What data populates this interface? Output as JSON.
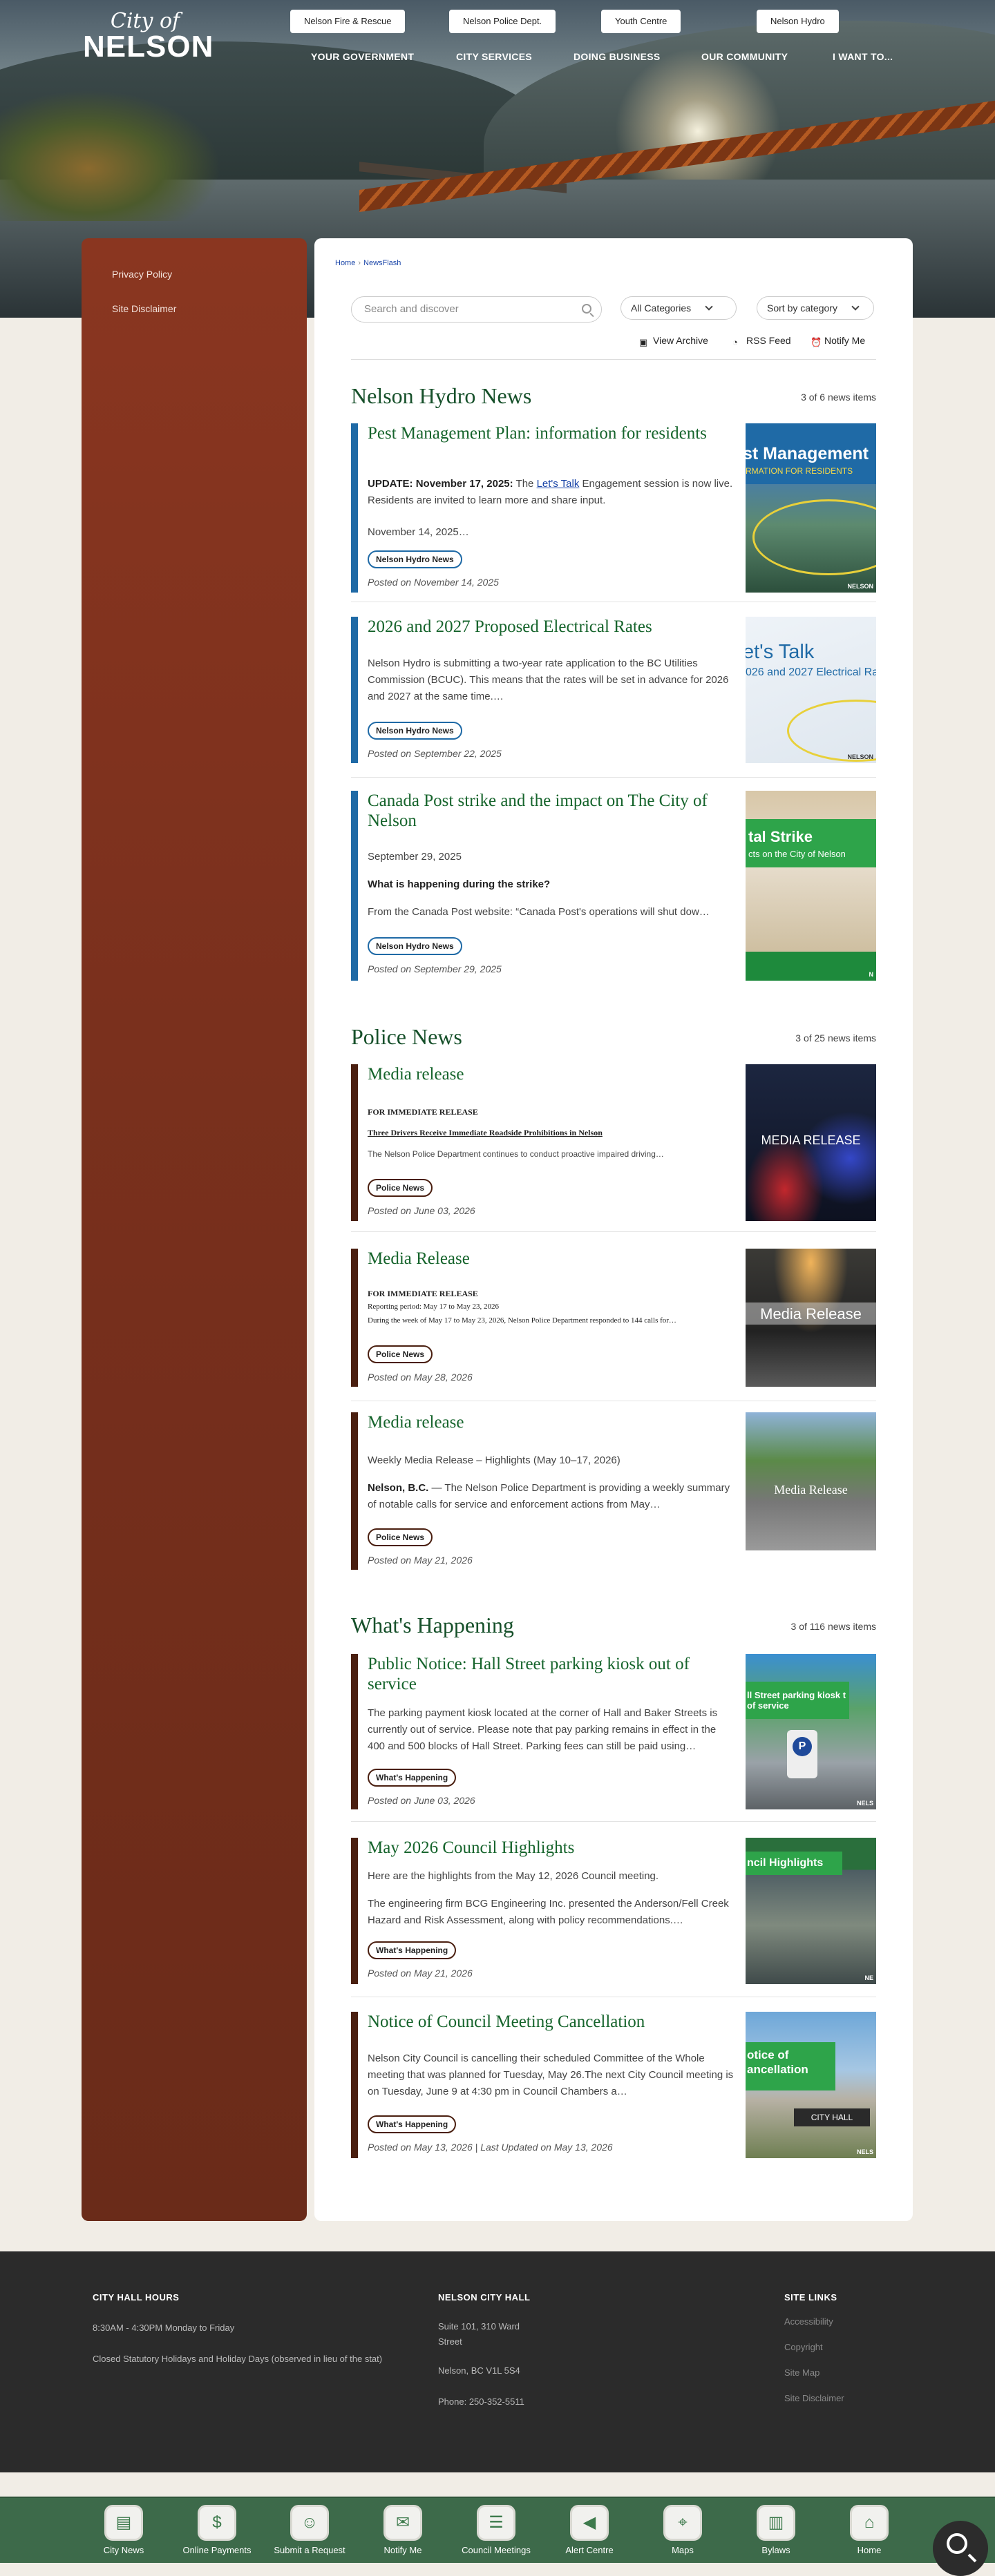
{
  "logo": {
    "city": "City of",
    "name": "NELSON"
  },
  "quick_links": [
    "Nelson Fire & Rescue",
    "Nelson Police Dept.",
    "Youth Centre",
    "Nelson Hydro"
  ],
  "nav": [
    "YOUR GOVERNMENT",
    "CITY SERVICES",
    "DOING BUSINESS",
    "OUR COMMUNITY",
    "I WANT TO..."
  ],
  "sidebar": {
    "links": [
      "Privacy Policy",
      "Site Disclaimer"
    ]
  },
  "breadcrumb": {
    "home": "Home",
    "sep": "›",
    "current": "NewsFlash"
  },
  "search": {
    "placeholder": "Search and discover"
  },
  "filters": {
    "category": "All Categories",
    "sort": "Sort by category"
  },
  "tools": {
    "archive": "View Archive",
    "rss": "RSS Feed",
    "notify": "Notify Me"
  },
  "colors": {
    "hydro": "#1f6aa6",
    "police": "#4a1f10",
    "happening": "#4a1f10",
    "title_green": "#16642c"
  },
  "sections": [
    {
      "title": "Nelson Hydro News",
      "count": "3 of 6 news items",
      "items": [
        {
          "title": "Pest Management Plan: information for residents",
          "update_label": "UPDATE: November 17, 2025:",
          "update_pre": " The ",
          "update_link": "Let's Talk",
          "update_post": " Engagement session is now live. Residents are invited to learn more and share input.",
          "date_line": "November 14, 2025…",
          "tag": "Nelson Hydro News",
          "posted": "Posted on November 14, 2025",
          "thumb": {
            "line1": "st Management",
            "line2": "RMATION FOR RESIDENTS",
            "corner": "NELSON"
          }
        },
        {
          "title": "2026 and 2027 Proposed Electrical Rates",
          "body": "Nelson Hydro is submitting a two-year rate application to the BC Utilities Commission (BCUC). This means that the rates will be set in advance for 2026 and 2027 at the same time.…",
          "tag": "Nelson Hydro News",
          "posted": "Posted on September 22, 2025",
          "thumb": {
            "line1": "et's Talk",
            "line2": "026 and 2027 Electrical Ra",
            "corner": "NELSON"
          }
        },
        {
          "title": "Canada Post strike and the impact on The City of Nelson",
          "date_line": "September 29, 2025",
          "question": "What is happening during the strike?",
          "body": "From the Canada Post website: “Canada Post's operations will shut dow…",
          "tag": "Nelson Hydro News",
          "posted": "Posted on September 29, 2025",
          "thumb": {
            "line1": "tal Strike",
            "line2": "cts on the City of Nelson",
            "corner": "N"
          }
        }
      ]
    },
    {
      "title": "Police News",
      "count": "3 of 25 news items",
      "items": [
        {
          "title": "Media release",
          "heading": "FOR IMMEDIATE RELEASE",
          "sub": "Three Drivers Receive Immediate Roadside Prohibitions in Nelson",
          "body": "The Nelson Police Department continues to conduct proactive impaired driving…",
          "tag": "Police News",
          "posted": "Posted on June 03, 2026",
          "thumb": {
            "line1": "MEDIA RELEASE"
          }
        },
        {
          "title": "Media Release",
          "heading": "FOR IMMEDIATE RELEASE",
          "sub": "Reporting period: May 17 to May 23, 2026",
          "body": "During the week of May 17 to May 23, 2026, Nelson Police Department responded to 144 calls for…",
          "tag": "Police News",
          "posted": "Posted on May 28, 2026",
          "thumb": {
            "line1": "Media Release"
          }
        },
        {
          "title": "Media release",
          "heading": "Weekly Media Release – Highlights (May 10–17, 2026)",
          "lead": "Nelson, B.C.",
          "body": " — The Nelson Police Department is providing a weekly summary of notable calls for service and enforcement actions from May…",
          "tag": "Police News",
          "posted": "Posted on May 21, 2026",
          "thumb": {
            "line1": "Media Release"
          }
        }
      ]
    },
    {
      "title": "What's Happening",
      "count": "3 of 116 news items",
      "items": [
        {
          "title": "Public Notice: Hall Street parking kiosk out of service",
          "body": "The parking payment kiosk located at the corner of Hall and Baker Streets is currently out of service. Please note that pay parking remains in effect in the 400 and 500 blocks of Hall Street. Parking fees can still be paid using…",
          "tag": "What's Happening",
          "posted": "Posted on June 03, 2026",
          "thumb": {
            "line1": "ll Street parking kiosk t of service",
            "corner": "NELS"
          }
        },
        {
          "title": "May 2026 Council Highlights",
          "line1": "Here are the highlights from the May 12, 2026 Council meeting.",
          "body": "The engineering firm BCG Engineering Inc. presented the Anderson/Fell Creek Hazard and Risk Assessment, along with policy recommendations.…",
          "tag": "What's Happening",
          "posted": "Posted on May 21, 2026",
          "thumb": {
            "line1": "ncil Highlights",
            "corner": "NE"
          }
        },
        {
          "title": "Notice of Council Meeting Cancellation",
          "body": "Nelson City Council is cancelling their scheduled Committee of the Whole meeting that was planned for Tuesday, May 26.The next City Council meeting is on Tuesday, June 9 at 4:30 pm in Council Chambers a…",
          "tag": "What's Happening",
          "posted": "Posted on May 13, 2026 | Last Updated on May 13, 2026",
          "thumb": {
            "line1": "otice of ancellation",
            "sign": "CITY HALL",
            "corner": "NELS"
          }
        }
      ]
    }
  ],
  "footer": {
    "hours_title": "CITY HALL HOURS",
    "hours": "8:30AM - 4:30PM Monday to Friday",
    "closed": "Closed Statutory Holidays and Holiday Days (observed in lieu of the stat)",
    "hall_title": "NELSON CITY HALL",
    "address1": "Suite 101, 310 Ward Street",
    "address2": "Nelson, BC V1L 5S4",
    "phone": "Phone: 250-352-5511",
    "links_title": "SITE LINKS",
    "links": [
      "Accessibility",
      "Copyright",
      "Site Map",
      "Site Disclaimer"
    ]
  },
  "bottom_bar": [
    {
      "label": "City News",
      "icon": "newspaper-icon"
    },
    {
      "label": "Online Payments",
      "icon": "dollar-icon"
    },
    {
      "label": "Submit a Request",
      "icon": "person-icon"
    },
    {
      "label": "Notify Me",
      "icon": "chat-icon"
    },
    {
      "label": "Council Meetings",
      "icon": "document-icon"
    },
    {
      "label": "Alert Centre",
      "icon": "megaphone-icon"
    },
    {
      "label": "Maps",
      "icon": "map-icon"
    },
    {
      "label": "Bylaws",
      "icon": "book-icon"
    },
    {
      "label": "Home",
      "icon": "home-icon"
    }
  ]
}
